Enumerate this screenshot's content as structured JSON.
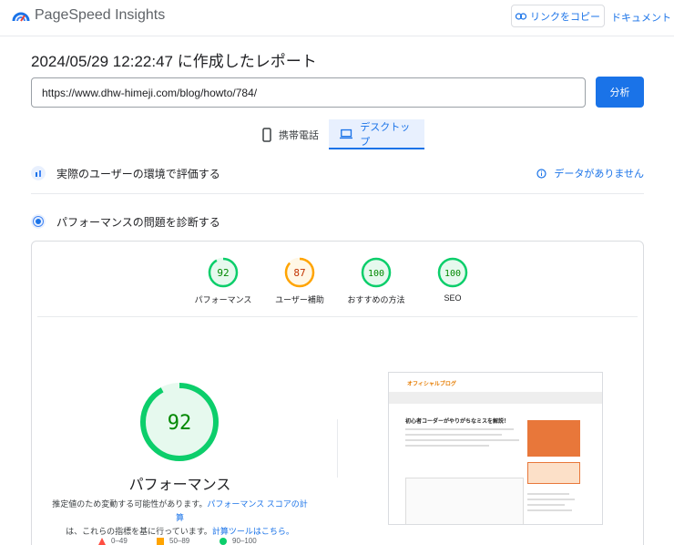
{
  "header": {
    "app_title": "PageSpeed Insights",
    "copy_link_label": "リンクをコピー",
    "docs_label": "ドキュメント"
  },
  "report": {
    "title": "2024/05/29 12:22:47 に作成したレポート",
    "url_value": "https://www.dhw-himeji.com/blog/howto/784/",
    "analyze_label": "分析"
  },
  "tabs": [
    {
      "label": "携帯電話",
      "icon": "phone-icon"
    },
    {
      "label": "デスクトップ",
      "icon": "laptop-icon",
      "selected": true
    }
  ],
  "crux": {
    "title": "実際のユーザーの環境で評価する",
    "no_data_label": "データがありません"
  },
  "lab": {
    "title": "パフォーマンスの問題を診断する"
  },
  "scores": [
    {
      "label": "パフォーマンス",
      "value": "92",
      "status": "pass"
    },
    {
      "label": "ユーザー補助",
      "value": "87",
      "status": "average"
    },
    {
      "label": "おすすめの方法",
      "value": "100",
      "status": "pass"
    },
    {
      "label": "SEO",
      "value": "100",
      "status": "pass"
    }
  ],
  "performance": {
    "score": "92",
    "title": "パフォーマンス",
    "desc_prefix": "推定値のため変動する可能性があります。",
    "desc_link1": "パフォーマンス スコアの計算",
    "desc_middle": "は、これらの指標を基に行っています。",
    "desc_link2": "計算ツールはこちら。"
  },
  "legend": [
    {
      "range": "0–49",
      "color": "#ff4e42"
    },
    {
      "range": "50–89",
      "color": "#ffa400"
    },
    {
      "range": "90–100",
      "color": "#0cce6b"
    }
  ],
  "thumbnail": {
    "site_logo": "オフィシャルブログ",
    "article_title": "初心者コーダーがやりがちなミスを解説！"
  },
  "colors": {
    "accent": "#1a73e8",
    "pass": "#0cce6b",
    "average": "#ffa400",
    "fail": "#ff4e42"
  }
}
